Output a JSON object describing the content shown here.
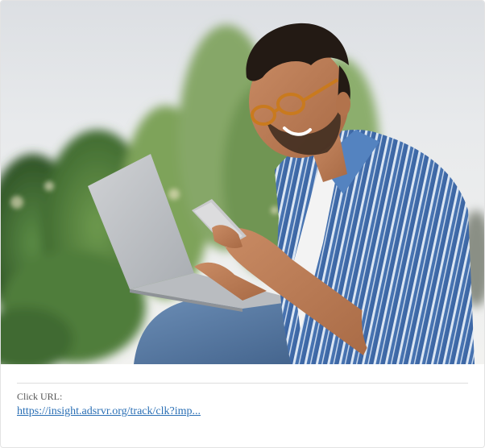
{
  "ad": {
    "image_alt": "Smiling man in glasses and a striped blue shirt using a smartphone with a laptop on his lap outdoors",
    "click_label": "Click URL:",
    "click_url": "https://insight.adsrvr.org/track/clk?imp..."
  },
  "colors": {
    "link": "#2a6fb5",
    "label": "#555555",
    "divider": "#dedede",
    "border": "#e3e3e3"
  }
}
